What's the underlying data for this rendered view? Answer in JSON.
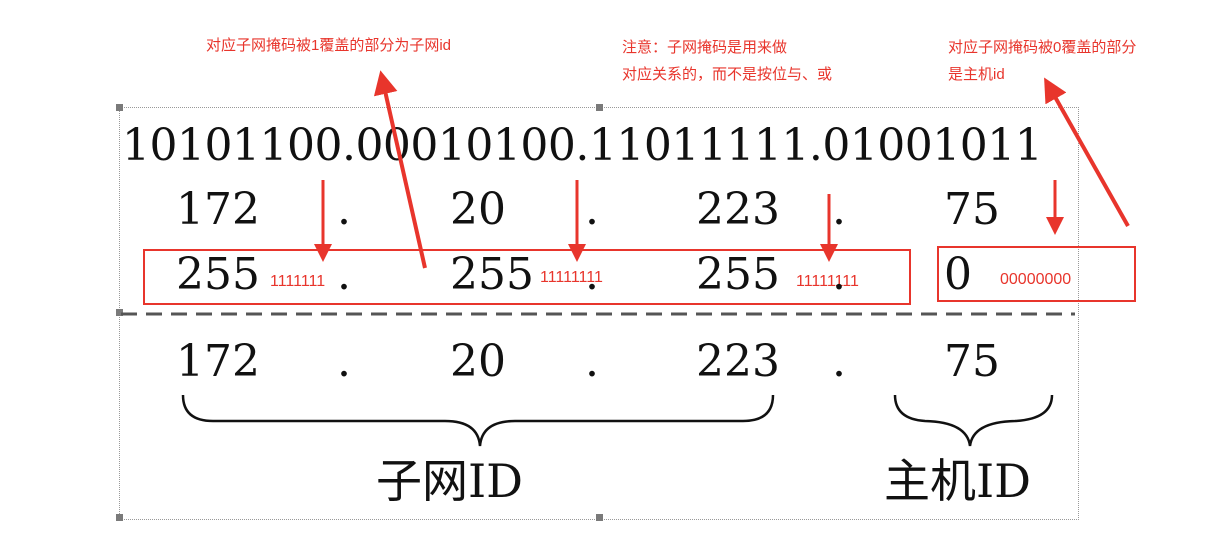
{
  "annotations": {
    "subnet_note": "对应子网掩码被1覆盖的部分为子网id",
    "attention_line1": "注意：子网掩码是用来做",
    "attention_line2": "对应关系的，而不是按位与、或",
    "host_note_line1": "对应子网掩码被0覆盖的部分",
    "host_note_line2": "是主机id"
  },
  "binary_row": "10101100.00010100.11011111.01001011",
  "ip_row": {
    "o1": "172",
    "o2": "20",
    "o3": "223",
    "o4": "75",
    "sep": "."
  },
  "mask_row": {
    "o1": "255",
    "o2": "255",
    "o3": "255",
    "o4": "0",
    "b1": "1111111",
    "b2": "11111111",
    "b3": "11111111",
    "b4": "00000000",
    "sep": "."
  },
  "result_row": {
    "o1": "172",
    "o2": "20",
    "o3": "223",
    "o4": "75",
    "sep": "."
  },
  "labels": {
    "subnet_id": "子网ID",
    "host_id": "主机ID"
  },
  "colors": {
    "accent_red": "#e8352c",
    "text": "#111111",
    "frame": "#999999"
  }
}
